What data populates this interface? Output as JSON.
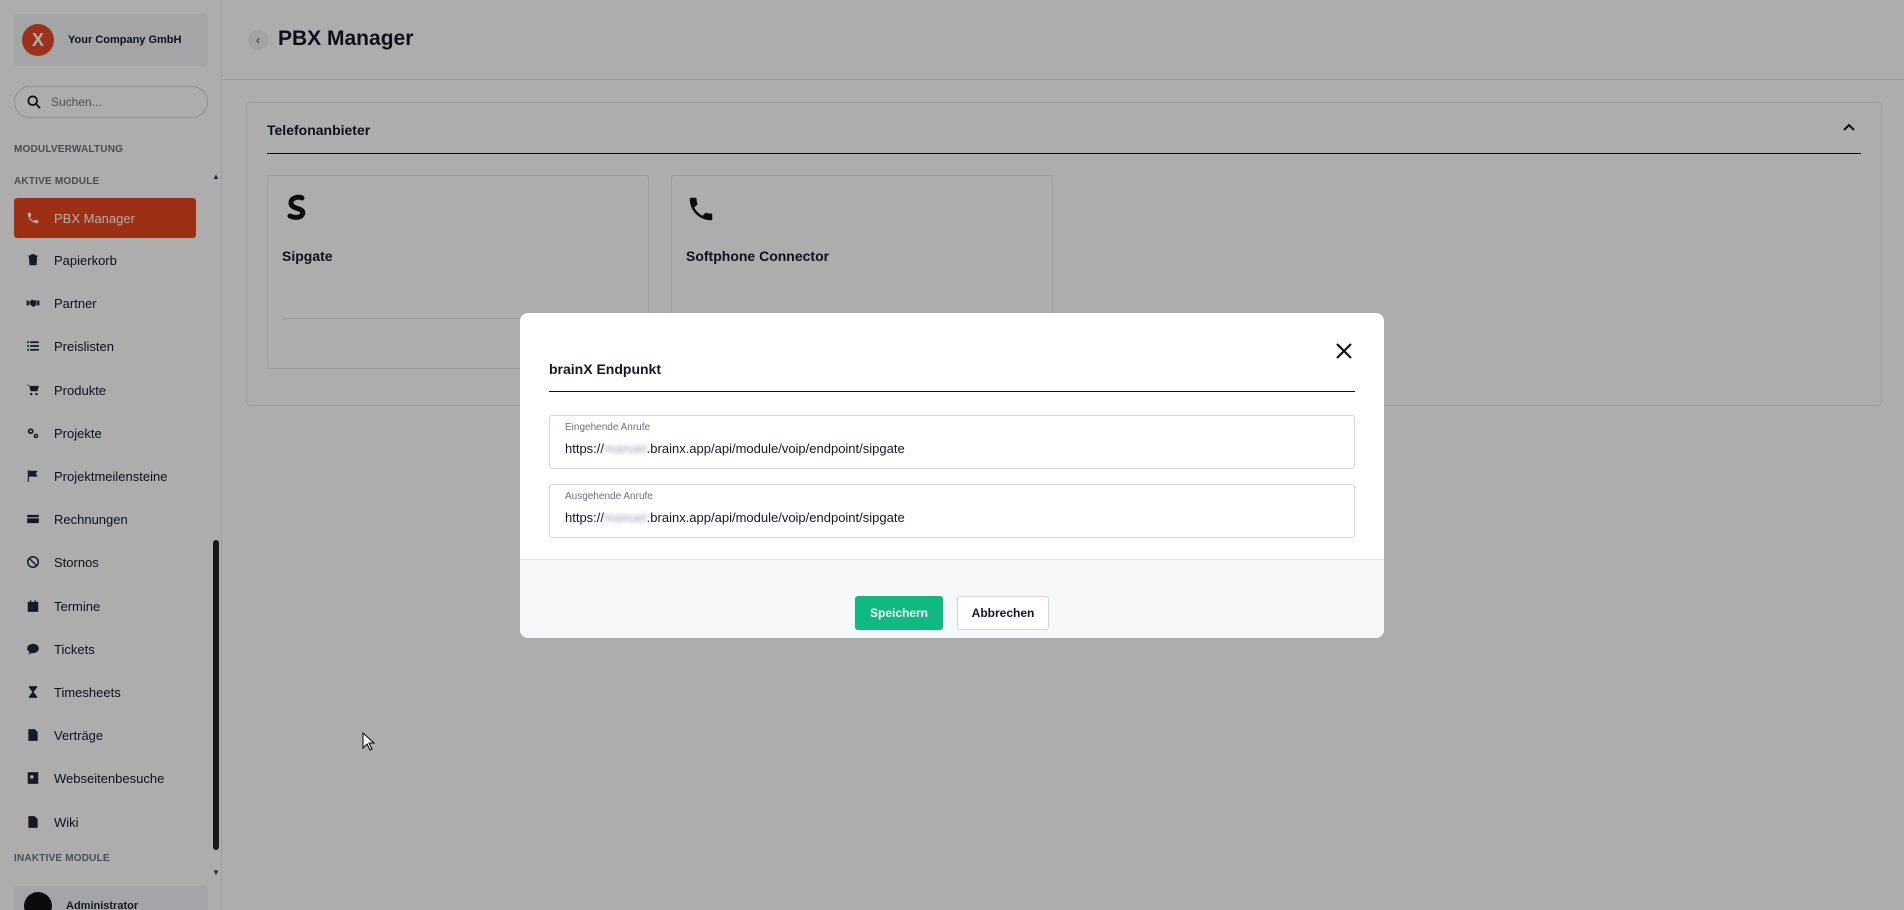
{
  "sidebar": {
    "company_name": "Your Company GmbH",
    "search_placeholder": "Suchen...",
    "section_modules": "MODULVERWALTUNG",
    "section_active": "AKTIVE MODULE",
    "section_inactive": "INAKTIVE MODULE",
    "items": [
      {
        "label": "PBX Manager",
        "icon": "phone-icon"
      },
      {
        "label": "Papierkorb",
        "icon": "trash-icon"
      },
      {
        "label": "Partner",
        "icon": "handshake-icon"
      },
      {
        "label": "Preislisten",
        "icon": "list-icon"
      },
      {
        "label": "Produkte",
        "icon": "cart-icon"
      },
      {
        "label": "Projekte",
        "icon": "gears-icon"
      },
      {
        "label": "Projektmeilensteine",
        "icon": "flag-icon"
      },
      {
        "label": "Rechnungen",
        "icon": "credit-card-icon"
      },
      {
        "label": "Stornos",
        "icon": "ban-icon"
      },
      {
        "label": "Termine",
        "icon": "calendar-icon"
      },
      {
        "label": "Tickets",
        "icon": "comment-icon"
      },
      {
        "label": "Timesheets",
        "icon": "hourglass-icon"
      },
      {
        "label": "Verträge",
        "icon": "file-contract-icon"
      },
      {
        "label": "Webseitenbesuche",
        "icon": "address-card-icon"
      },
      {
        "label": "Wiki",
        "icon": "file-word-icon"
      }
    ],
    "user_label": "Administrator"
  },
  "header": {
    "title": "PBX Manager"
  },
  "panel": {
    "title": "Telefonanbieter",
    "cards": [
      {
        "name": "Sipgate",
        "icon": "sipgate-icon"
      },
      {
        "name": "Softphone Connector",
        "icon": "phone-icon"
      }
    ]
  },
  "modal": {
    "title": "brainX Endpunkt",
    "incoming_label": "Eingehende Anrufe",
    "incoming_prefix": "https://",
    "incoming_blurred": "manuel",
    "incoming_suffix": ".brainx.app/api/module/voip/endpoint/sipgate",
    "outgoing_label": "Ausgehende Anrufe",
    "outgoing_prefix": "https://",
    "outgoing_blurred": "manuel",
    "outgoing_suffix": ".brainx.app/api/module/voip/endpoint/sipgate",
    "save_label": "Speichern",
    "cancel_label": "Abbrechen"
  },
  "colors": {
    "accent": "#e8461f",
    "save": "#10b981"
  }
}
